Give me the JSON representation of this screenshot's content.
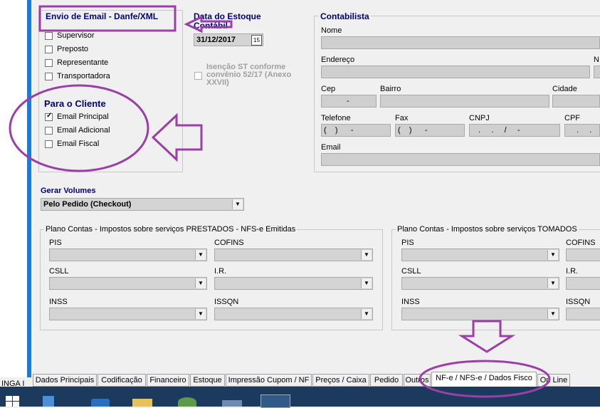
{
  "left_strip": {
    "label": "INGA I"
  },
  "envio_email": {
    "title": "Envio de Email - Danfe/XML",
    "options": [
      {
        "label": "Supervisor",
        "checked": false
      },
      {
        "label": "Preposto",
        "checked": false
      },
      {
        "label": "Representante",
        "checked": false
      },
      {
        "label": "Transportadora",
        "checked": false
      }
    ],
    "cliente_title": "Para o Cliente",
    "cliente_options": [
      {
        "label": "Email Principal",
        "checked": true
      },
      {
        "label": "Email Adicional",
        "checked": false
      },
      {
        "label": "Email Fiscal",
        "checked": false
      }
    ]
  },
  "estoque": {
    "label": "Data do Estoque Contábil",
    "value": "31/12/2017",
    "calendar_label": "15"
  },
  "isencao": {
    "label": "Isenção ST conforme convênio 52/17 (Anexo XXVII)",
    "checked": false
  },
  "contabilista": {
    "title": "Contabilista",
    "nome_label": "Nome",
    "endereco_label": "Endereço",
    "n_label": "N",
    "cep_label": "Cep",
    "cep_mask": "-",
    "bairro_label": "Bairro",
    "cidade_label": "Cidade",
    "telefone_label": "Telefone",
    "telefone_mask": "(    )      -",
    "fax_label": "Fax",
    "fax_mask": "(    )      -",
    "cnpj_label": "CNPJ",
    "cnpj_mask": ".     .     /     -",
    "cpf_label": "CPF",
    "cpf_mask": ".     .     -",
    "email_label": "Email"
  },
  "gerar_volumes": {
    "label": "Gerar Volumes",
    "value": "Pelo Pedido (Checkout)"
  },
  "prestados": {
    "title": "Plano Contas - Impostos sobre serviços PRESTADOS - NFS-e Emitidas",
    "fields": [
      "PIS",
      "COFINS",
      "CSLL",
      "I.R.",
      "INSS",
      "ISSQN"
    ]
  },
  "tomados": {
    "title": "Plano Contas - Impostos sobre serviços TOMADOS",
    "fields": [
      "PIS",
      "COFINS",
      "CSLL",
      "I.R.",
      "INSS",
      "ISSQN"
    ]
  },
  "tabs": [
    "Dados Principais",
    "Codificação",
    "Financeiro",
    "Estoque",
    "Impressão Cupom / NF",
    "Preços / Caixa",
    "Pedido",
    "Outros",
    "NF-e / NFS-e / Dados Fisco",
    "On Line"
  ],
  "annotation_color": "#9b3fa8"
}
